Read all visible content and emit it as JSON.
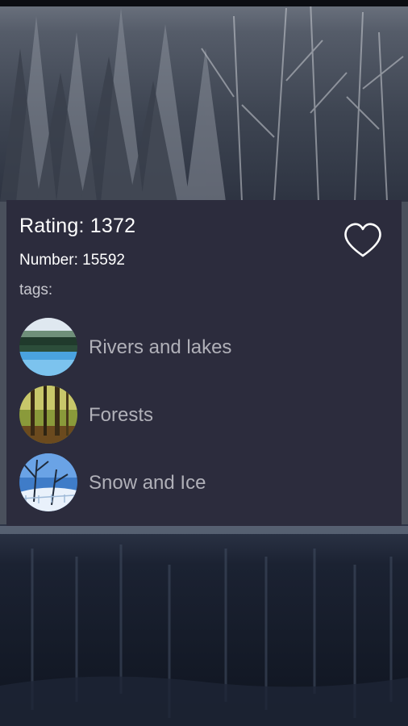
{
  "photo": {
    "rating_line": "Rating: 1372",
    "number_line": "Number: 15592",
    "tags_label": "tags:",
    "favorite_icon": "heart-outline-icon"
  },
  "tags": [
    {
      "label": "Rivers and lakes",
      "thumbnail": "river-lake-thumbnail"
    },
    {
      "label": "Forests",
      "thumbnail": "forest-thumbnail"
    },
    {
      "label": "Snow and Ice",
      "thumbnail": "snow-ice-thumbnail"
    }
  ],
  "colors": {
    "card_background": "#2c2c3d",
    "primary_text": "#ffffff",
    "secondary_text": "#b0b0b8"
  }
}
